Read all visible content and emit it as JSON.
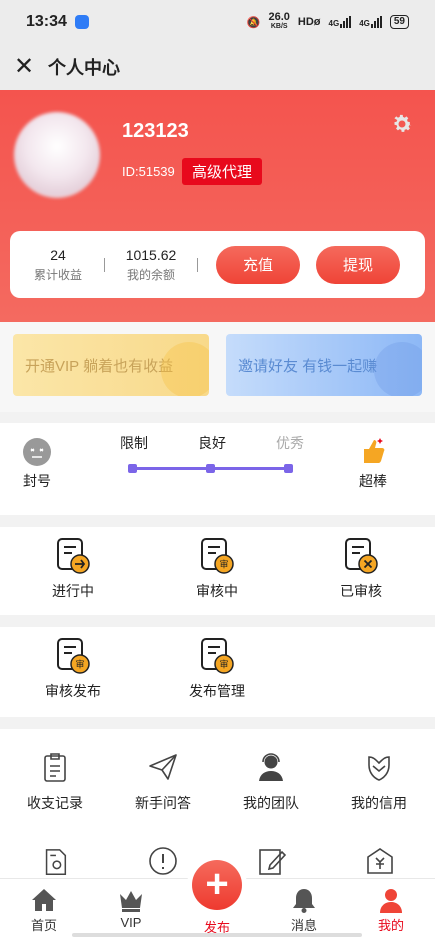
{
  "status_bar": {
    "time": "13:34",
    "speed": "26.0",
    "speed_unit": "KB/S",
    "hd": "HDø",
    "net1": "4G",
    "net2": "4G",
    "battery": "59"
  },
  "nav": {
    "title": "个人中心"
  },
  "profile": {
    "username": "123123",
    "id_text": "ID:51539",
    "badge": "高级代理"
  },
  "wallet": {
    "total_income": {
      "value": "24",
      "label": "累计收益"
    },
    "balance": {
      "value": "1015.62",
      "label": "我的余额"
    },
    "recharge_label": "充值",
    "withdraw_label": "提现"
  },
  "promos": {
    "vip": "开通VIP 躺着也有收益",
    "invite": "邀请好友 有钱一起赚"
  },
  "credit": {
    "left_label": "封号",
    "right_label": "超棒",
    "levels": [
      "限制",
      "良好",
      "优秀"
    ],
    "current_level": "良好"
  },
  "tasks": {
    "row1": [
      "进行中",
      "审核中",
      "已审核"
    ],
    "row2": [
      "审核发布",
      "发布管理"
    ],
    "badge_char": "审"
  },
  "services": [
    "收支记录",
    "新手问答",
    "我的团队",
    "我的信用"
  ],
  "tabbar": {
    "items": [
      "首页",
      "VIP",
      "发布",
      "消息",
      "我的"
    ],
    "active": "我的",
    "publish_plus": "+"
  },
  "colors": {
    "brand_red": "#f4544e",
    "badge_red": "#e8091c",
    "accent_orange": "#f5a623",
    "progress_purple": "#7b65e8"
  }
}
